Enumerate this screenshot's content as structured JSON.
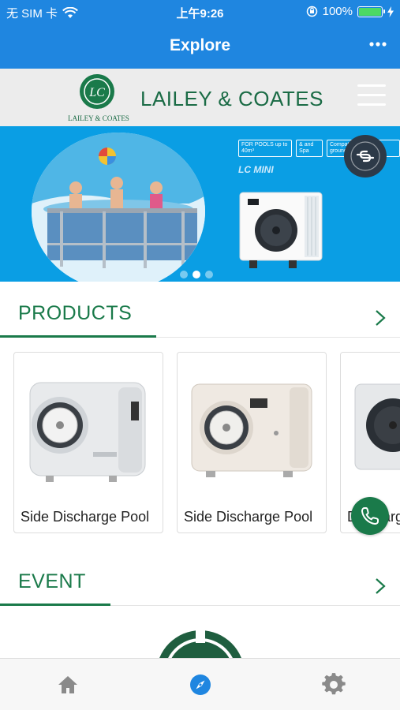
{
  "status_bar": {
    "carrier": "无 SIM 卡",
    "time": "上午9:26",
    "battery": "100%",
    "battery_level": 1.0,
    "icons": [
      "wifi-icon",
      "orientation-lock-icon",
      "battery-icon",
      "charging-icon"
    ]
  },
  "nav": {
    "title": "Explore",
    "more_icon": "more-icon"
  },
  "brand": {
    "logo_initials": "LC",
    "logo_caption": "LAILEY & COATES",
    "name": "LAILEY & COATES",
    "menu_icon": "hamburger-menu-icon"
  },
  "banner": {
    "badges": [
      "FOR POOLS up to 40m³",
      "& and Spa",
      "Compatible all above ground pools"
    ],
    "model": "LC MINI",
    "link_icon": "link-icon",
    "slide_count": 3,
    "active_slide": 2
  },
  "products": {
    "title": "PRODUCTS",
    "items": [
      {
        "label": "Side Discharge Pool"
      },
      {
        "label": "Side Discharge Pool"
      },
      {
        "label": "Discharge Pool"
      }
    ]
  },
  "event": {
    "title": "EVENT"
  },
  "tab_bar": {
    "tabs": [
      {
        "icon": "home-icon",
        "active": false
      },
      {
        "icon": "compass-icon",
        "active": true
      },
      {
        "icon": "gear-icon",
        "active": false
      }
    ]
  },
  "colors": {
    "nav_blue": "#1f86e0",
    "brand_green": "#1a7a4a",
    "banner_blue": "#0a9ee4"
  }
}
